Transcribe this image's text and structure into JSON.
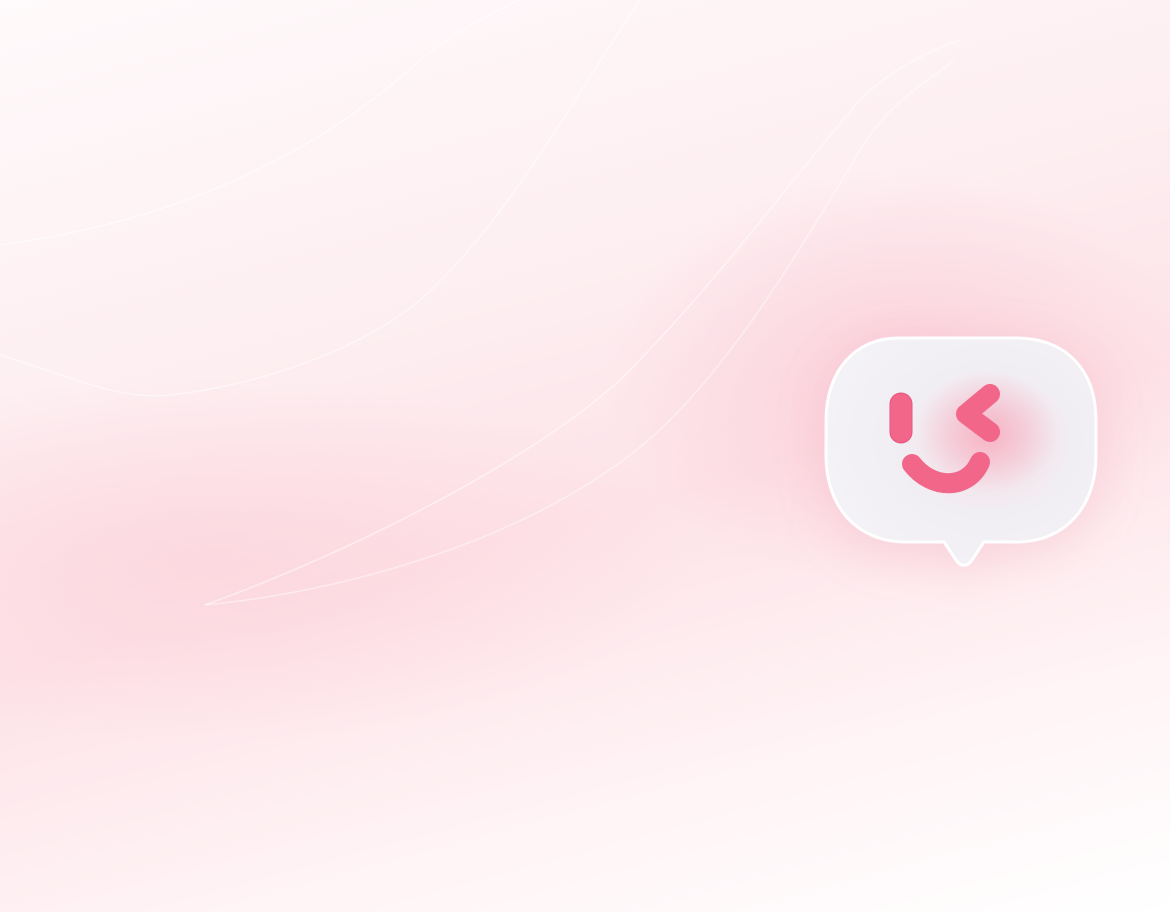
{
  "scene": {
    "background_colors": [
      "#fffafb",
      "#fde3e8",
      "#ffffff"
    ],
    "accent_color": "#f2668a",
    "bubble_color": "#f3f2f6",
    "icon": "winking-chat-bubble-icon"
  }
}
